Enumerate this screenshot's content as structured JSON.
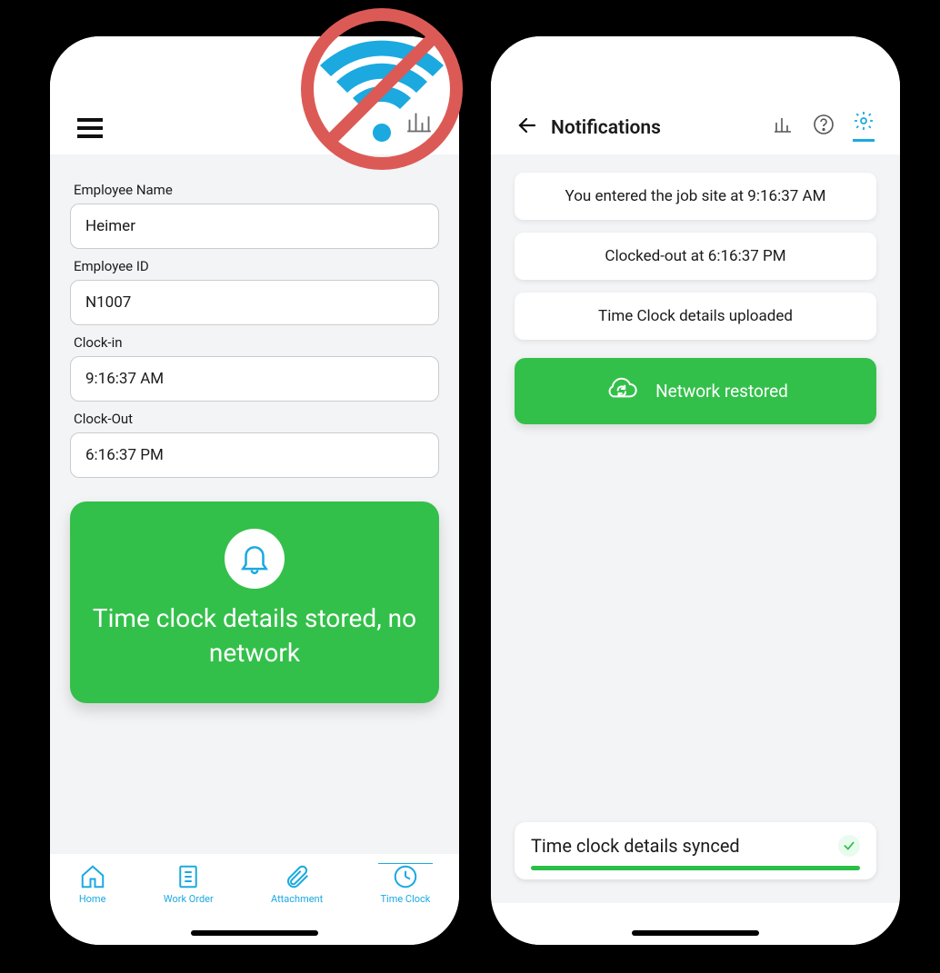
{
  "left": {
    "fields": [
      {
        "label": "Employee Name",
        "value": "Heimer"
      },
      {
        "label": "Employee ID",
        "value": "N1007"
      },
      {
        "label": "Clock-in",
        "value": "9:16:37 AM"
      },
      {
        "label": "Clock-Out",
        "value": "6:16:37 PM"
      }
    ],
    "status_card": "Time clock details stored, no network",
    "nav": [
      {
        "label": "Home",
        "icon": "home-icon"
      },
      {
        "label": "Work Order",
        "icon": "work-order-icon"
      },
      {
        "label": "Attachment",
        "icon": "attachment-icon"
      },
      {
        "label": "Time Clock",
        "icon": "time-clock-icon",
        "active": true
      }
    ]
  },
  "right": {
    "title": "Notifications",
    "notifications": [
      "You entered the job site at 9:16:37 AM",
      "Clocked-out at  6:16:37 PM",
      "Time Clock details uploaded"
    ],
    "banner": "Network restored",
    "synced_text": "Time clock details  synced"
  },
  "colors": {
    "accent": "#1ba9e0",
    "green": "#33c04a"
  }
}
